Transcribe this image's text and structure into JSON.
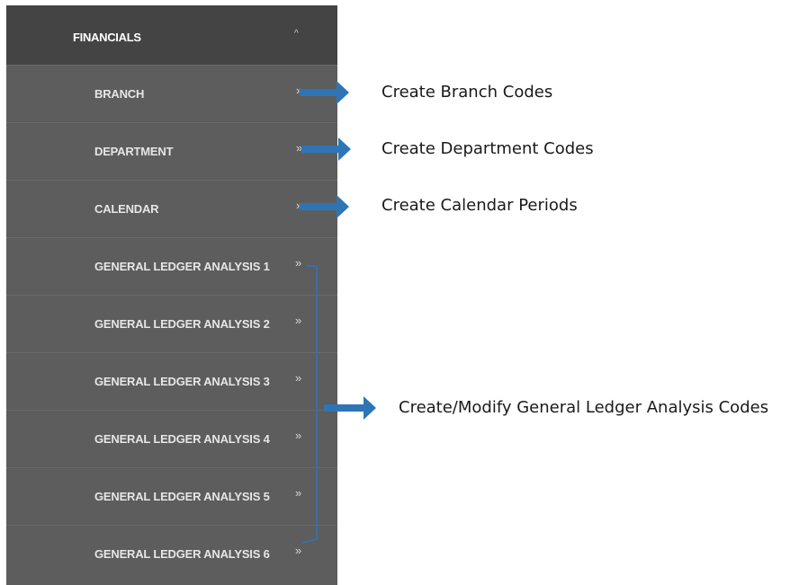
{
  "menu": {
    "header_label": "FINANCIALS",
    "header_caret": "^",
    "items": [
      {
        "label": "BRANCH",
        "chevron": "»"
      },
      {
        "label": "DEPARTMENT",
        "chevron": "»"
      },
      {
        "label": "CALENDAR",
        "chevron": "»"
      },
      {
        "label": "GENERAL LEDGER ANALYSIS 1",
        "chevron": "»"
      },
      {
        "label": "GENERAL LEDGER ANALYSIS 2",
        "chevron": "»"
      },
      {
        "label": "GENERAL LEDGER ANALYSIS 3",
        "chevron": "»"
      },
      {
        "label": "GENERAL LEDGER ANALYSIS 4",
        "chevron": "»"
      },
      {
        "label": "GENERAL LEDGER ANALYSIS 5",
        "chevron": "»"
      },
      {
        "label": "GENERAL LEDGER ANALYSIS 6",
        "chevron": "»"
      }
    ]
  },
  "annotations": {
    "branch": "Create Branch Codes",
    "department": "Create Department Codes",
    "calendar": "Create Calendar Periods",
    "gl_analysis": "Create/Modify General Ledger Analysis Codes"
  },
  "colors": {
    "sidebar_bg": "#5d5d5d",
    "header_bg": "#444444",
    "arrow": "#2e75b6"
  }
}
